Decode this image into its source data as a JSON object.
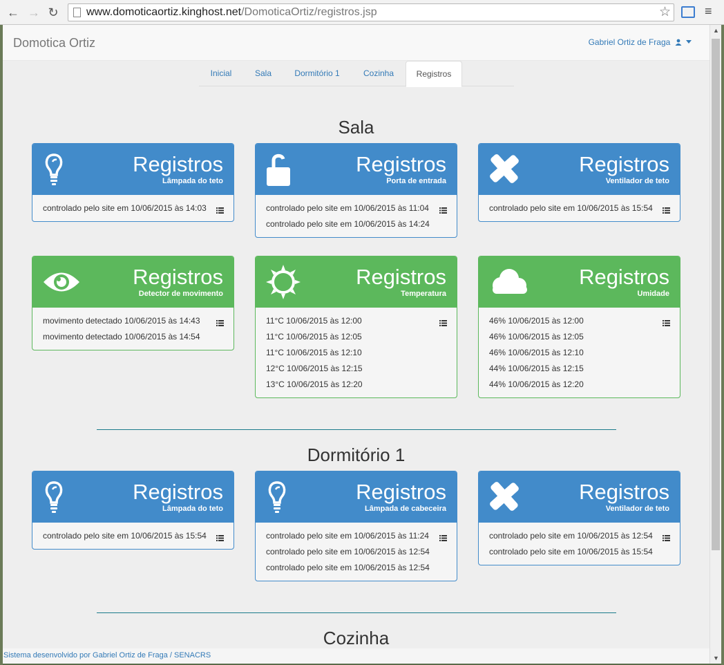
{
  "browser": {
    "url_host": "www.domoticaortiz.kinghost.net",
    "url_path": "/DomoticaOrtiz/registros.jsp"
  },
  "navbar": {
    "brand": "Domotica Ortiz",
    "user": "Gabriel Ortiz de Fraga"
  },
  "tabs": [
    "Inicial",
    "Sala",
    "Dormitório 1",
    "Cozinha",
    "Registros"
  ],
  "panel_title": "Registros",
  "sections": [
    {
      "title": "Sala",
      "panels": [
        {
          "device": "Lâmpada do teto",
          "icon": "lightbulb-icon",
          "color": "blue",
          "entries": [
            "controlado pelo site em 10/06/2015 às 14:03"
          ]
        },
        {
          "device": "Porta de entrada",
          "icon": "unlock-icon",
          "color": "blue",
          "entries": [
            "controlado pelo site em 10/06/2015 às 11:04",
            "controlado pelo site em 10/06/2015 às 14:24"
          ]
        },
        {
          "device": "Ventilador de teto",
          "icon": "fan-icon",
          "color": "blue",
          "entries": [
            "controlado pelo site em 10/06/2015 às 15:54"
          ]
        },
        {
          "device": "Detector de movimento",
          "icon": "eye-icon",
          "color": "green",
          "entries": [
            "movimento detectado 10/06/2015 às 14:43",
            "movimento detectado 10/06/2015 às 14:54"
          ]
        },
        {
          "device": "Temperatura",
          "icon": "sun-icon",
          "color": "green",
          "entries": [
            "11°C 10/06/2015 às 12:00",
            "11°C 10/06/2015 às 12:05",
            "11°C 10/06/2015 às 12:10",
            "12°C 10/06/2015 às 12:15",
            "13°C 10/06/2015 às 12:20"
          ]
        },
        {
          "device": "Umidade",
          "icon": "cloud-icon",
          "color": "green",
          "entries": [
            "46% 10/06/2015 às 12:00",
            "46% 10/06/2015 às 12:05",
            "46% 10/06/2015 às 12:10",
            "44% 10/06/2015 às 12:15",
            "44% 10/06/2015 às 12:20"
          ]
        }
      ]
    },
    {
      "title": "Dormitório 1",
      "panels": [
        {
          "device": "Lâmpada do teto",
          "icon": "lightbulb-icon",
          "color": "blue",
          "entries": [
            "controlado pelo site em 10/06/2015 às 15:54"
          ]
        },
        {
          "device": "Lâmpada de cabeceira",
          "icon": "lightbulb-icon",
          "color": "blue",
          "entries": [
            "controlado pelo site em 10/06/2015 às 11:24",
            "controlado pelo site em 10/06/2015 às 12:54",
            "controlado pelo site em 10/06/2015 às 12:54"
          ]
        },
        {
          "device": "Ventilador de teto",
          "icon": "fan-icon",
          "color": "blue",
          "entries": [
            "controlado pelo site em 10/06/2015 às 12:54",
            "controlado pelo site em 10/06/2015 às 15:54"
          ]
        }
      ]
    },
    {
      "title": "Cozinha",
      "panels": []
    }
  ],
  "footer": "Sistema desenvolvido por Gabriel Ortiz de Fraga / SENACRS"
}
